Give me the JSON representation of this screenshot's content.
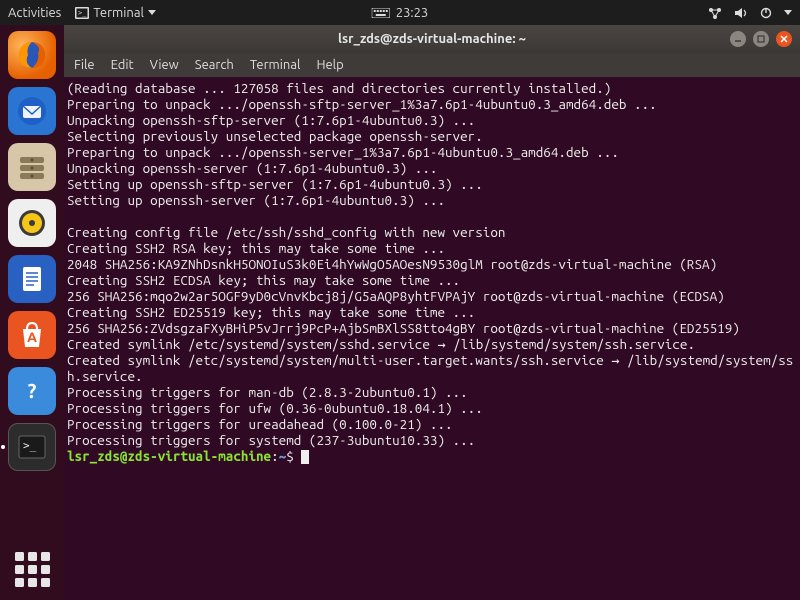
{
  "top_panel": {
    "activities": "Activities",
    "app_label": "Terminal",
    "time": "23:23"
  },
  "launcher": {
    "items": [
      {
        "name": "firefox",
        "label": "Firefox"
      },
      {
        "name": "thunderbird",
        "label": "Thunderbird"
      },
      {
        "name": "files",
        "label": "Files"
      },
      {
        "name": "rhythmbox",
        "label": "Rhythmbox"
      },
      {
        "name": "writer",
        "label": "LibreOffice Writer"
      },
      {
        "name": "software",
        "label": "Ubuntu Software"
      },
      {
        "name": "help",
        "label": "Help"
      },
      {
        "name": "terminal",
        "label": "Terminal"
      }
    ]
  },
  "window": {
    "title": "lsr_zds@zds-virtual-machine: ~",
    "menus": [
      "File",
      "Edit",
      "View",
      "Search",
      "Terminal",
      "Help"
    ]
  },
  "terminal": {
    "lines": [
      "(Reading database ... 127058 files and directories currently installed.)",
      "Preparing to unpack .../openssh-sftp-server_1%3a7.6p1-4ubuntu0.3_amd64.deb ...",
      "Unpacking openssh-sftp-server (1:7.6p1-4ubuntu0.3) ...",
      "Selecting previously unselected package openssh-server.",
      "Preparing to unpack .../openssh-server_1%3a7.6p1-4ubuntu0.3_amd64.deb ...",
      "Unpacking openssh-server (1:7.6p1-4ubuntu0.3) ...",
      "Setting up openssh-sftp-server (1:7.6p1-4ubuntu0.3) ...",
      "Setting up openssh-server (1:7.6p1-4ubuntu0.3) ...",
      "",
      "Creating config file /etc/ssh/sshd_config with new version",
      "Creating SSH2 RSA key; this may take some time ...",
      "2048 SHA256:KA9ZNhDsnkH5ONOIuS3k0Ei4hYwWgO5AOesN9530glM root@zds-virtual-machine (RSA)",
      "Creating SSH2 ECDSA key; this may take some time ...",
      "256 SHA256:mqo2w2ar5OGF9yD0cVnvKbcj8j/G5aAQP8yhtFVPAjY root@zds-virtual-machine (ECDSA)",
      "Creating SSH2 ED25519 key; this may take some time ...",
      "256 SHA256:ZVdsgzaFXyBHiP5vJrrj9PcP+AjbSmBXlSS8tto4gBY root@zds-virtual-machine (ED25519)",
      "Created symlink /etc/systemd/system/sshd.service → /lib/systemd/system/ssh.service.",
      "Created symlink /etc/systemd/system/multi-user.target.wants/ssh.service → /lib/systemd/system/ssh.service.",
      "Processing triggers for man-db (2.8.3-2ubuntu0.1) ...",
      "Processing triggers for ufw (0.36-0ubuntu0.18.04.1) ...",
      "Processing triggers for ureadahead (0.100.0-21) ...",
      "Processing triggers for systemd (237-3ubuntu10.33) ..."
    ],
    "prompt_user_host": "lsr_zds@zds-virtual-machine",
    "prompt_sep": ":",
    "prompt_path": "~",
    "prompt_end": "$ "
  }
}
